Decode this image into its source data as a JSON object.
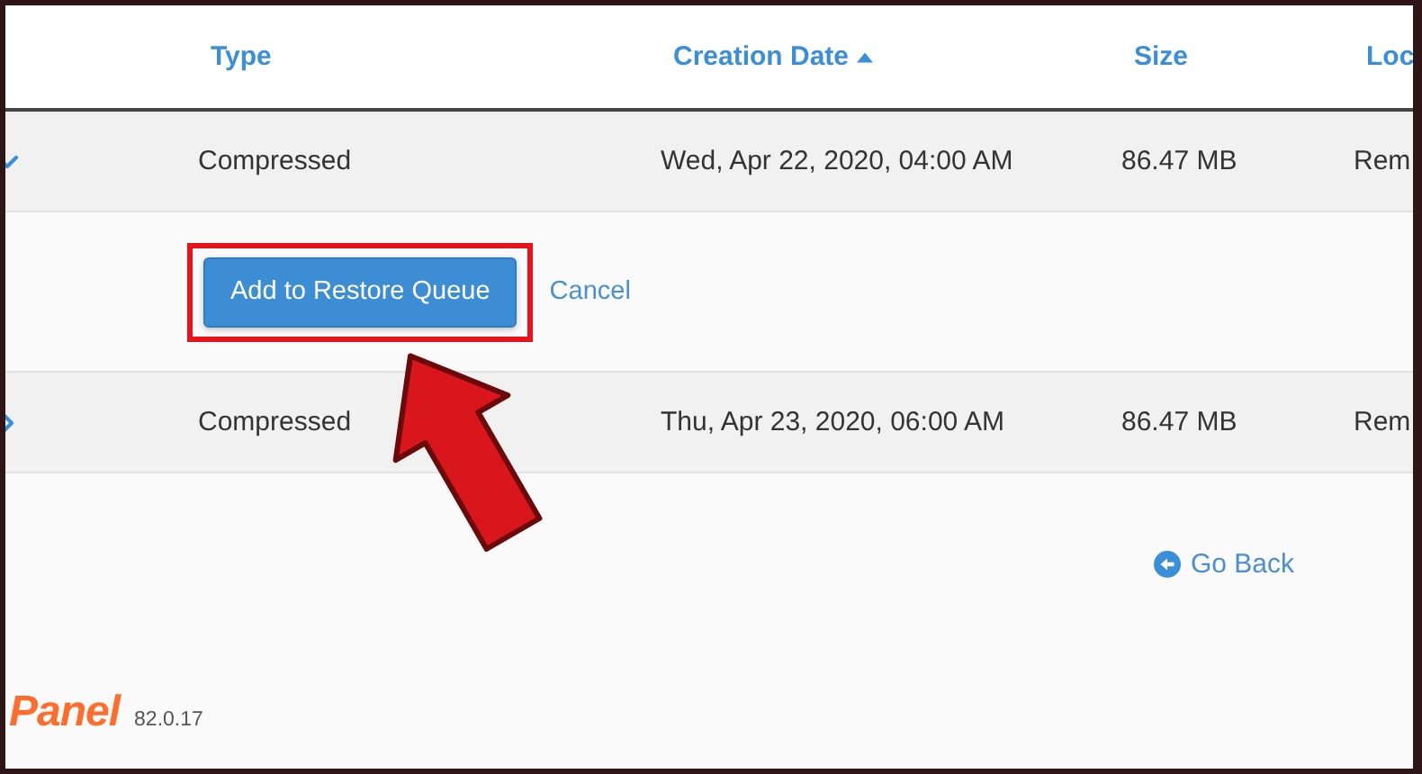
{
  "table": {
    "columns": [
      {
        "label": "Type",
        "sorted": false
      },
      {
        "label": "Creation Date",
        "sorted": true
      },
      {
        "label": "Size",
        "sorted": false
      },
      {
        "label": "Loc",
        "sorted": false
      }
    ],
    "rows": [
      {
        "expanded": true,
        "type": "Compressed",
        "creation_date": "Wed, Apr 22, 2020, 04:00 AM",
        "size": "86.47 MB",
        "location": "Rem"
      },
      {
        "expanded": false,
        "type": "Compressed",
        "creation_date": "Thu, Apr 23, 2020, 06:00 AM",
        "size": "86.47 MB",
        "location": "Rem"
      }
    ]
  },
  "restore_actions": {
    "button": "Add to Restore Queue",
    "cancel": "Cancel",
    "highlighted": true
  },
  "go_back": "Go Back",
  "footer": {
    "logo": "Panel",
    "version": "82.0.17"
  }
}
